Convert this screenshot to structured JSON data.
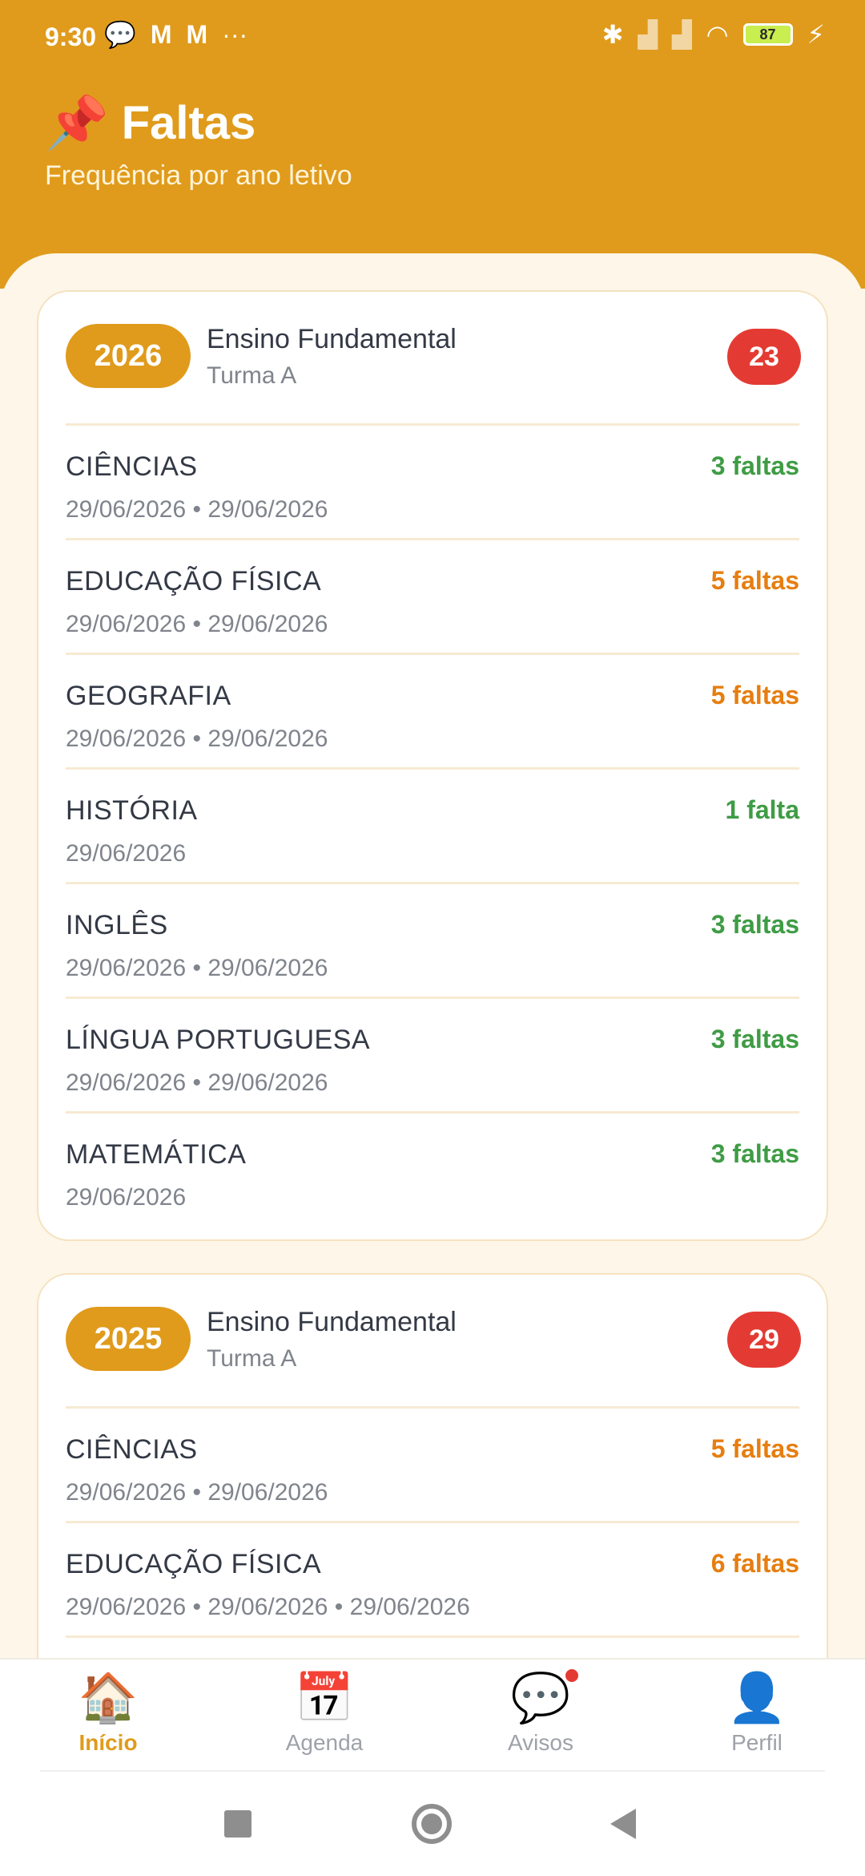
{
  "status_bar": {
    "time": "9:30",
    "battery": "87"
  },
  "header": {
    "pin_icon": "📌",
    "title": "Faltas",
    "subtitle": "Frequência por ano letivo"
  },
  "cards": [
    {
      "year": "2026",
      "level": "Ensino Fundamental",
      "turma": "Turma A",
      "total": "23",
      "rows": [
        {
          "subject": "CIÊNCIAS",
          "dates": "29/06/2026 • 29/06/2026",
          "faltas": "3 faltas",
          "color": "green"
        },
        {
          "subject": "EDUCAÇÃO FÍSICA",
          "dates": "29/06/2026 • 29/06/2026",
          "faltas": "5 faltas",
          "color": "orange"
        },
        {
          "subject": "GEOGRAFIA",
          "dates": "29/06/2026 • 29/06/2026",
          "faltas": "5 faltas",
          "color": "orange"
        },
        {
          "subject": "HISTÓRIA",
          "dates": "29/06/2026",
          "faltas": "1 falta",
          "color": "green"
        },
        {
          "subject": "INGLÊS",
          "dates": "29/06/2026 • 29/06/2026",
          "faltas": "3 faltas",
          "color": "green"
        },
        {
          "subject": "LÍNGUA PORTUGUESA",
          "dates": "29/06/2026 • 29/06/2026",
          "faltas": "3 faltas",
          "color": "green"
        },
        {
          "subject": "MATEMÁTICA",
          "dates": "29/06/2026",
          "faltas": "3 faltas",
          "color": "green"
        }
      ]
    },
    {
      "year": "2025",
      "level": "Ensino Fundamental",
      "turma": "Turma A",
      "total": "29",
      "rows": [
        {
          "subject": "CIÊNCIAS",
          "dates": "29/06/2026 • 29/06/2026",
          "faltas": "5 faltas",
          "color": "orange"
        },
        {
          "subject": "EDUCAÇÃO FÍSICA",
          "dates": "29/06/2026 • 29/06/2026 • 29/06/2026",
          "faltas": "6 faltas",
          "color": "orange"
        }
      ]
    }
  ],
  "bottom_nav": [
    {
      "icon": "🏠",
      "icon_name": "home-icon",
      "label": "Início",
      "active": true
    },
    {
      "icon": "📅",
      "icon_name": "calendar-icon",
      "label": "Agenda",
      "active": false
    },
    {
      "icon": "💬",
      "icon_name": "chat-icon",
      "label": "Avisos",
      "active": false
    },
    {
      "icon": "👤",
      "icon_name": "profile-icon",
      "label": "Perfil",
      "active": false
    }
  ],
  "colors": {
    "accent": "#E09B1C",
    "badge_red": "#E33B33",
    "green": "#3F9C45",
    "orange": "#E67E10"
  }
}
